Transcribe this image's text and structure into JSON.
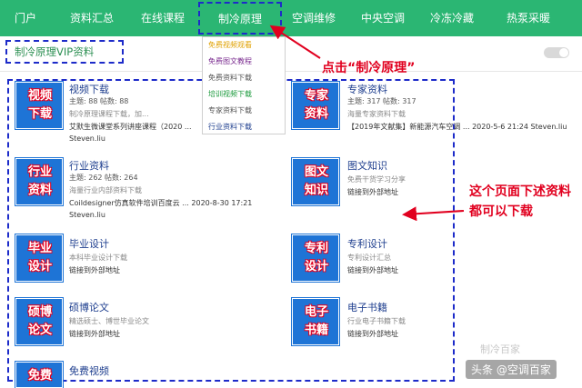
{
  "nav": {
    "items": [
      "门户",
      "资料汇总",
      "在线课程",
      "制冷原理",
      "空调维修",
      "中央空调",
      "冷冻冷藏",
      "热泵采暖"
    ],
    "active": "制冷原理",
    "bg_color": "#2bb673"
  },
  "dropdown": {
    "items": [
      {
        "label": "免费视频观看",
        "color": "#e0a100"
      },
      {
        "label": "免费图文教程",
        "color": "#7a2b8f"
      },
      {
        "label": "免费资料下载",
        "color": "#555555"
      },
      {
        "label": "培训视频下载",
        "color": "#1b9a3c"
      },
      {
        "label": "专家资料下载",
        "color": "#555555"
      },
      {
        "label": "行业资料下载",
        "color": "#1f3f8f"
      }
    ]
  },
  "breadcrumb": {
    "title": "制冷原理VIP资料"
  },
  "annotations": {
    "click_hint": "点击“制冷原理”",
    "download_hint": "这个页面下述资料都可以下载"
  },
  "forums": [
    {
      "icon_lines": [
        "视频",
        "下载"
      ],
      "title": "视频下载",
      "meta": "主题: 88  帖数: 88",
      "desc": "制冷原理课程下载，加...",
      "last": "艾默生微课堂系列讲座课程（2020 ...",
      "user": "Steven.liu"
    },
    {
      "icon_lines": [
        "专家",
        "资料"
      ],
      "title": "专家资料",
      "meta": "主题: 317  帖数: 317",
      "desc": "海量专家资料下载",
      "last": "【2019年文献集】新能源汽车空调 ... 2020-5-6 21:24 Steven.liu",
      "user": ""
    },
    {
      "icon_lines": [
        "行业",
        "资料"
      ],
      "title": "行业资料",
      "meta": "主题: 262  帖数: 264",
      "desc": "海量行业内部资料下载",
      "last": "Coildesigner仿真软件培训百度云 ... 2020-8-30 17:21",
      "user": "Steven.liu"
    },
    {
      "icon_lines": [
        "图文",
        "知识"
      ],
      "title": "图文知识",
      "meta": "",
      "desc": "免费干货学习分享",
      "last": "链接到外部地址",
      "user": ""
    },
    {
      "icon_lines": [
        "毕业",
        "设计"
      ],
      "title": "毕业设计",
      "meta": "",
      "desc": "本科毕业设计下载",
      "last": "链接到外部地址",
      "user": ""
    },
    {
      "icon_lines": [
        "专利",
        "设计"
      ],
      "title": "专利设计",
      "meta": "",
      "desc": "专利设计汇总",
      "last": "链接到外部地址",
      "user": ""
    },
    {
      "icon_lines": [
        "硕博",
        "论文"
      ],
      "title": "硕博论文",
      "meta": "",
      "desc": "精选硕士、博世毕业论文",
      "last": "链接到外部地址",
      "user": ""
    },
    {
      "icon_lines": [
        "电子",
        "书籍"
      ],
      "title": "电子书籍",
      "meta": "",
      "desc": "行业电子书籍下载",
      "last": "链接到外部地址",
      "user": ""
    },
    {
      "icon_lines": [
        "免费",
        ""
      ],
      "title": "免费视频",
      "meta": "",
      "desc": "",
      "last": "",
      "user": ""
    }
  ],
  "watermark": {
    "main": "头条 @空调百家",
    "faint": "制冷百家"
  },
  "colors": {
    "accent_red": "#e1001f",
    "dash_blue": "#1d2bc9",
    "tile_blue": "#1e74d6"
  }
}
